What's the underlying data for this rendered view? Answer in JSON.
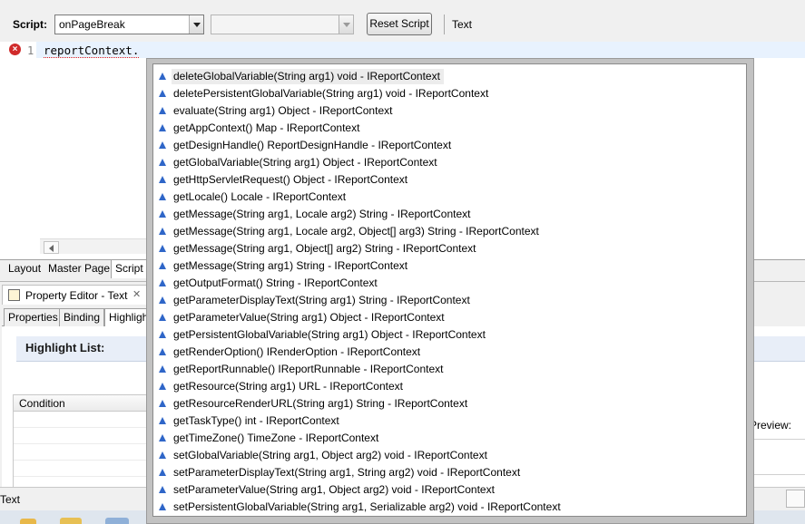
{
  "toolbar": {
    "script_label": "Script:",
    "script_value": "onPageBreak",
    "secondary_value": "",
    "reset_label": "Reset Script",
    "text_label": "Text"
  },
  "editor": {
    "line_number": "1",
    "code": "reportContext."
  },
  "editor_tabs": [
    {
      "label": "Layout"
    },
    {
      "label": "Master Page"
    },
    {
      "label": "Script"
    }
  ],
  "property_editor": {
    "title": "Property Editor - Text",
    "close_glyph": "✕",
    "tabs": [
      {
        "label": "Properties"
      },
      {
        "label": "Binding"
      },
      {
        "label": "Highlights"
      }
    ],
    "highlight_list_title": "Highlight List:",
    "condition_header": "Condition",
    "preview_label": "Preview:"
  },
  "status": {
    "text": "Text"
  },
  "assist": {
    "icon": "public-method-icon",
    "icon_color": "#2f66c8",
    "selected_index": 0,
    "items": [
      "deleteGlobalVariable(String arg1) void - IReportContext",
      "deletePersistentGlobalVariable(String arg1) void - IReportContext",
      "evaluate(String arg1) Object - IReportContext",
      "getAppContext() Map - IReportContext",
      "getDesignHandle() ReportDesignHandle - IReportContext",
      "getGlobalVariable(String arg1) Object - IReportContext",
      "getHttpServletRequest() Object - IReportContext",
      "getLocale() Locale - IReportContext",
      "getMessage(String arg1, Locale arg2) String - IReportContext",
      "getMessage(String arg1, Locale arg2, Object[] arg3) String - IReportContext",
      "getMessage(String arg1, Object[] arg2) String - IReportContext",
      "getMessage(String arg1) String - IReportContext",
      "getOutputFormat() String - IReportContext",
      "getParameterDisplayText(String arg1) String - IReportContext",
      "getParameterValue(String arg1) Object - IReportContext",
      "getPersistentGlobalVariable(String arg1) Object - IReportContext",
      "getRenderOption() IRenderOption - IReportContext",
      "getReportRunnable() IReportRunnable - IReportContext",
      "getResource(String arg1) URL - IReportContext",
      "getResourceRenderURL(String arg1) String - IReportContext",
      "getTaskType() int - IReportContext",
      "getTimeZone() TimeZone - IReportContext",
      "setGlobalVariable(String arg1, Object arg2) void - IReportContext",
      "setParameterDisplayText(String arg1, String arg2) void - IReportContext",
      "setParameterValue(String arg1, Object arg2) void - IReportContext",
      "setPersistentGlobalVariable(String arg1, Serializable arg2) void - IReportContext"
    ]
  }
}
